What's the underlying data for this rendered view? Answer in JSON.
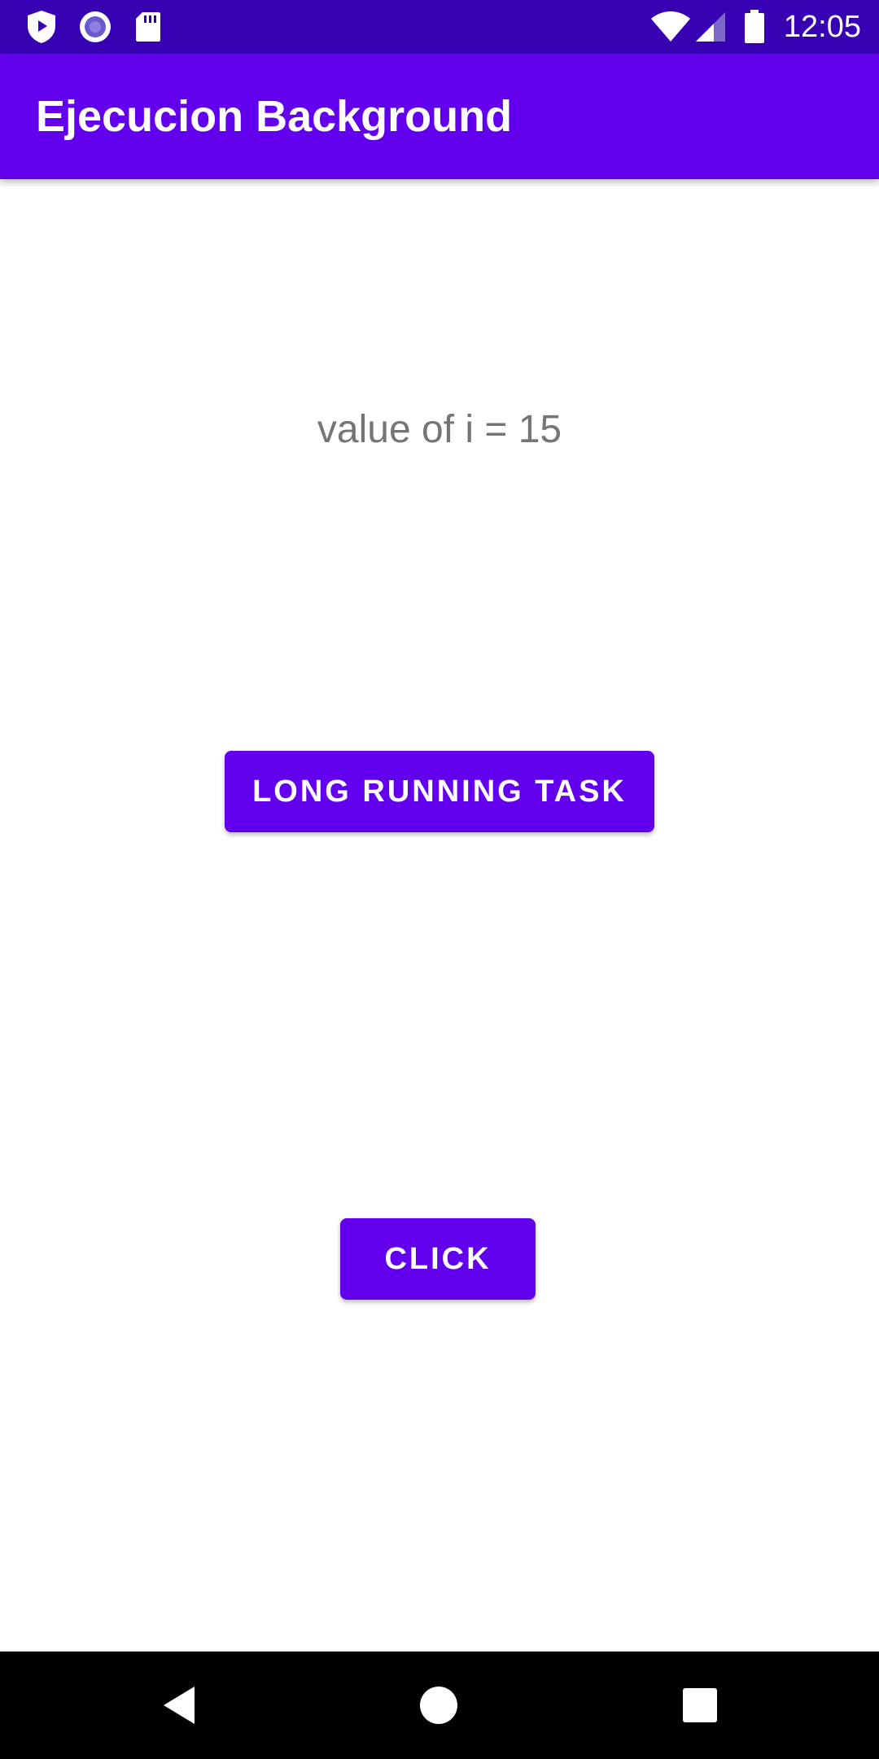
{
  "status_bar": {
    "time": "12:05",
    "background_color": "#3700b3",
    "icons_left": [
      "shield-play-icon",
      "radio-record-icon",
      "sd-card-icon"
    ],
    "icons_right": [
      "wifi-icon",
      "cell-signal-icon",
      "battery-icon"
    ]
  },
  "app_bar": {
    "title": "Ejecucion Background",
    "background_color": "#6200ee"
  },
  "main": {
    "value_text": "value of i = 15",
    "long_task_button_label": "LONG RUNNING TASK",
    "click_button_label": "CLICK",
    "button_color": "#6200ee"
  },
  "nav_bar": {
    "buttons": [
      "back-icon",
      "home-icon",
      "recents-icon"
    ]
  }
}
